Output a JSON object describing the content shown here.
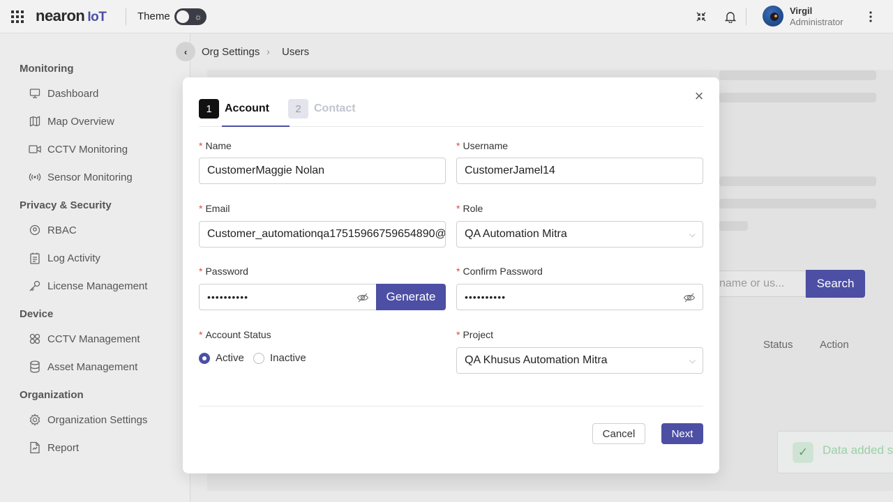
{
  "topbar": {
    "logo_text": "nearon",
    "logo_suffix": "IoT",
    "theme_label": "Theme",
    "user_name": "Virgil",
    "user_role": "Administrator"
  },
  "sidebar": {
    "sections": [
      {
        "title": "Monitoring",
        "items": [
          {
            "label": "Dashboard",
            "icon": "monitor-icon"
          },
          {
            "label": "Map Overview",
            "icon": "map-icon"
          },
          {
            "label": "CCTV Monitoring",
            "icon": "video-icon"
          },
          {
            "label": "Sensor Monitoring",
            "icon": "sensor-icon"
          }
        ]
      },
      {
        "title": "Privacy & Security",
        "items": [
          {
            "label": "RBAC",
            "icon": "rbac-icon"
          },
          {
            "label": "Log Activity",
            "icon": "log-icon"
          },
          {
            "label": "License Management",
            "icon": "key-icon"
          }
        ]
      },
      {
        "title": "Device",
        "items": [
          {
            "label": "CCTV Management",
            "icon": "grid-icon"
          },
          {
            "label": "Asset Management",
            "icon": "database-icon"
          }
        ]
      },
      {
        "title": "Organization",
        "items": [
          {
            "label": "Organization Settings",
            "icon": "gear-icon"
          },
          {
            "label": "Report",
            "icon": "report-icon"
          }
        ]
      }
    ]
  },
  "breadcrumb": {
    "items": [
      "Org Settings",
      "Users"
    ]
  },
  "background": {
    "search_placeholder": "name or us...",
    "search_button": "Search",
    "table_headers": [
      "Status",
      "Action"
    ],
    "toast_message": "Data added s"
  },
  "modal": {
    "steps": [
      {
        "number": "1",
        "label": "Account"
      },
      {
        "number": "2",
        "label": "Contact"
      }
    ],
    "fields": {
      "name": {
        "label": "Name",
        "value": "CustomerMaggie Nolan"
      },
      "username": {
        "label": "Username",
        "value": "CustomerJamel14"
      },
      "email": {
        "label": "Email",
        "value": "Customer_automationqa17515966759654890@"
      },
      "role": {
        "label": "Role",
        "value": "QA Automation Mitra"
      },
      "password": {
        "label": "Password",
        "value": "••••••••••"
      },
      "confirm_password": {
        "label": "Confirm Password",
        "value": "••••••••••"
      },
      "account_status": {
        "label": "Account Status",
        "options": [
          "Active",
          "Inactive"
        ],
        "selected": "Active"
      },
      "project": {
        "label": "Project",
        "value": "QA Khusus Automation Mitra"
      }
    },
    "generate_button": "Generate",
    "cancel_button": "Cancel",
    "next_button": "Next"
  }
}
